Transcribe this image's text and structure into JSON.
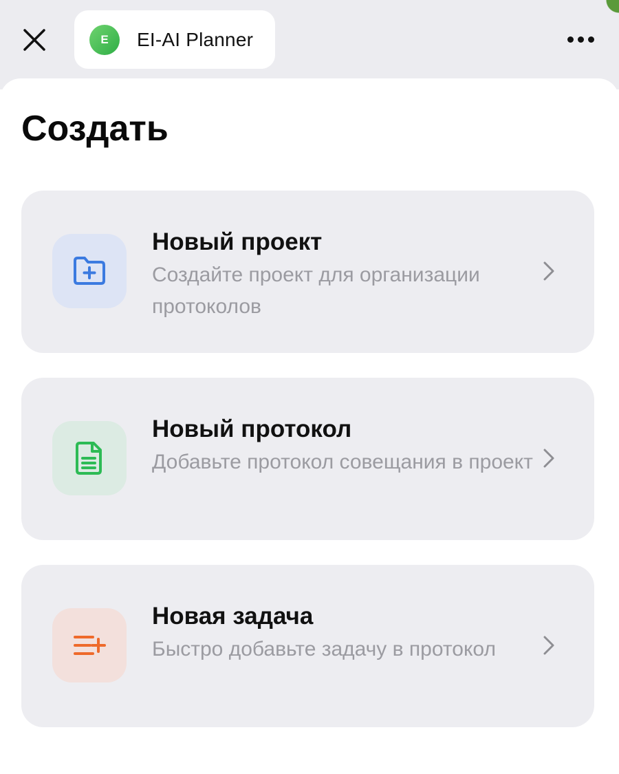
{
  "header": {
    "app_logo_letter": "E",
    "app_name": "EI-AI Planner",
    "close_icon": "close-icon",
    "more_icon": "more-horizontal-icon"
  },
  "page": {
    "title": "Создать"
  },
  "cards": [
    {
      "title": "Новый проект",
      "description": "Создайте проект для организации протоколов",
      "icon": "folder-plus-icon",
      "icon_color": "#3b7ae0",
      "icon_bg": "#dde4f5"
    },
    {
      "title": "Новый протокол",
      "description": "Добавьте протокол совещания в проект",
      "icon": "document-icon",
      "icon_color": "#2dbb55",
      "icon_bg": "#dcebe3"
    },
    {
      "title": "Новая задача",
      "description": "Быстро добавьте задачу в протокол",
      "icon": "list-plus-icon",
      "icon_color": "#ee6a2b",
      "icon_bg": "#f3e0dc"
    }
  ],
  "colors": {
    "background_top": "#ececf0",
    "card_background": "#ededf1",
    "secondary_text": "#9b9ba1",
    "chevron": "#8e8e93"
  }
}
